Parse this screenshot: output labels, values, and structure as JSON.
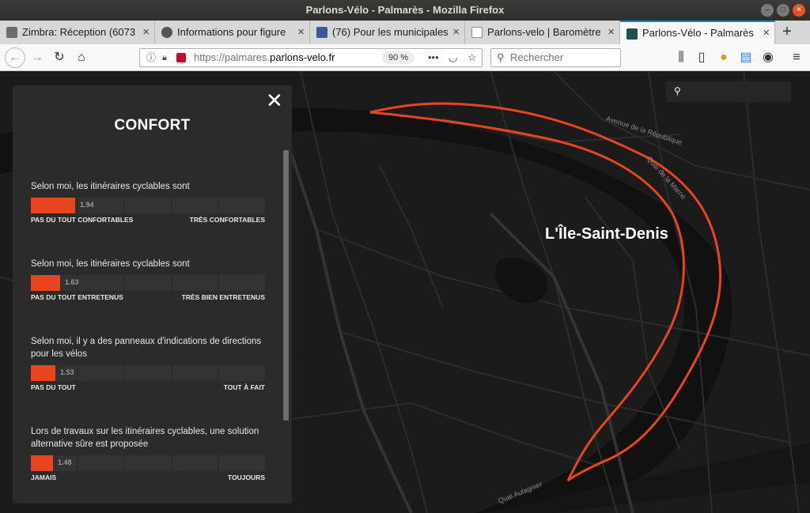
{
  "window": {
    "title": "Parlons-Vélo - Palmarès - Mozilla Firefox"
  },
  "tabs": [
    {
      "label": "Zimbra: Réception (6073",
      "icon": "zimbra-icon",
      "color": "#6c6c6c"
    },
    {
      "label": "Informations pour figure",
      "icon": "site-icon",
      "color": "#555555"
    },
    {
      "label": "(76) Pour les municipales",
      "icon": "facebook-icon",
      "color": "#3b5998"
    },
    {
      "label": "Parlons-velo | Baromètre",
      "icon": "page-icon",
      "color": "#2a6db0"
    },
    {
      "label": "Parlons-Vélo - Palmarès",
      "icon": "site-icon",
      "color": "#1f4f4f"
    }
  ],
  "navbar": {
    "url_prefix": "https://palmares.",
    "url_domain": "parlons-velo.fr",
    "zoom": "90 %",
    "search_placeholder": "Rechercher"
  },
  "map": {
    "city_label": "L'Île-Saint-Denis",
    "streets": [
      "Avenue de la République",
      "Quai de la Marne",
      "Quai Aulagnier"
    ],
    "outline_color": "#e8441e"
  },
  "panel": {
    "title": "CONFORT",
    "questions": [
      {
        "text": "Selon moi, les itinéraires cyclables sont",
        "value": "1.94",
        "score": 1.94,
        "min_label": "PAS DU TOUT CONFORTABLES",
        "max_label": "TRÈS CONFORTABLES"
      },
      {
        "text": "Selon moi, les itinéraires cyclables sont",
        "value": "1.63",
        "score": 1.63,
        "min_label": "PAS DU TOUT ENTRETENUS",
        "max_label": "TRÈS BIEN ENTRETENUS"
      },
      {
        "text": "Selon moi, il y a des panneaux d'indications de directions pour les vélos",
        "value": "1.53",
        "score": 1.53,
        "min_label": "PAS DU TOUT",
        "max_label": "TOUT À FAIT"
      },
      {
        "text": "Lors de travaux sur les itinéraires cyclables, une solution alternative sûre est proposée",
        "value": "1.48",
        "score": 1.48,
        "min_label": "JAMAIS",
        "max_label": "TOUJOURS"
      }
    ],
    "scale_min": 1,
    "scale_max": 6,
    "fill_color": "#e8441e"
  }
}
